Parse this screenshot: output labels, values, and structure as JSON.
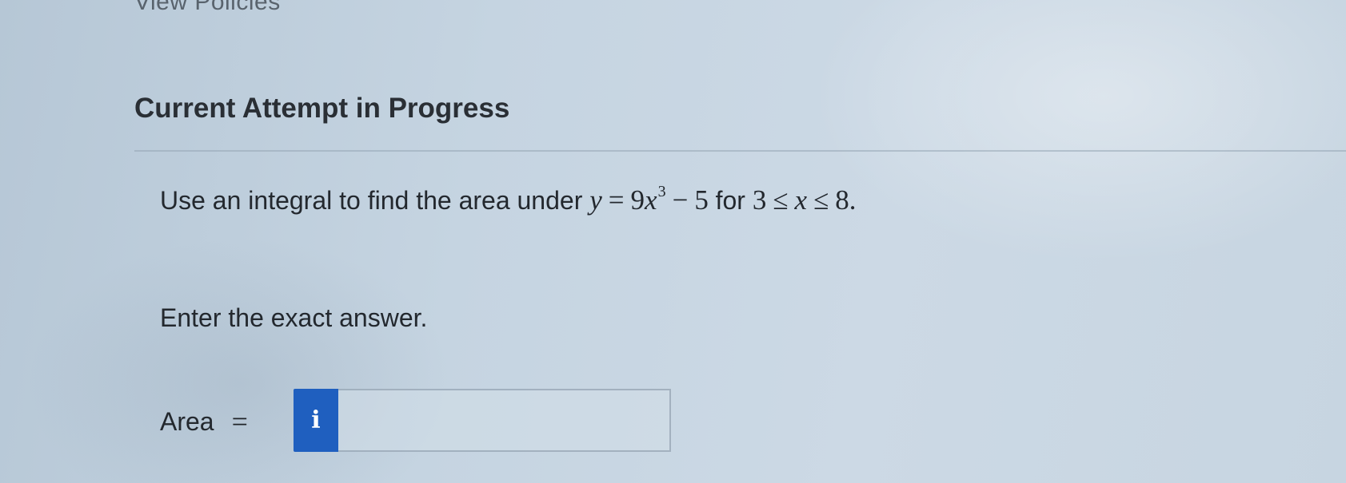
{
  "header": {
    "top_link": "View Policies",
    "attempt_title": "Current Attempt in Progress"
  },
  "question": {
    "prefix": "Use an integral to find the area under",
    "y_var": "y",
    "equals": "=",
    "coefficient": "9",
    "x_var": "x",
    "exponent": "3",
    "minus": "−",
    "constant": "5",
    "for_word": "for",
    "lower_bound": "3",
    "leq_1": "≤",
    "x_var_2": "x",
    "leq_2": "≤",
    "upper_bound": "8",
    "period": "."
  },
  "instruction": "Enter the exact answer.",
  "answer": {
    "label": "Area",
    "equals": "=",
    "info_icon": "info-icon",
    "info_glyph": "i",
    "value": "",
    "placeholder": ""
  },
  "colors": {
    "info_button": "#1f5fbf",
    "title_text": "#2a2f35",
    "body_text": "#23282e"
  }
}
